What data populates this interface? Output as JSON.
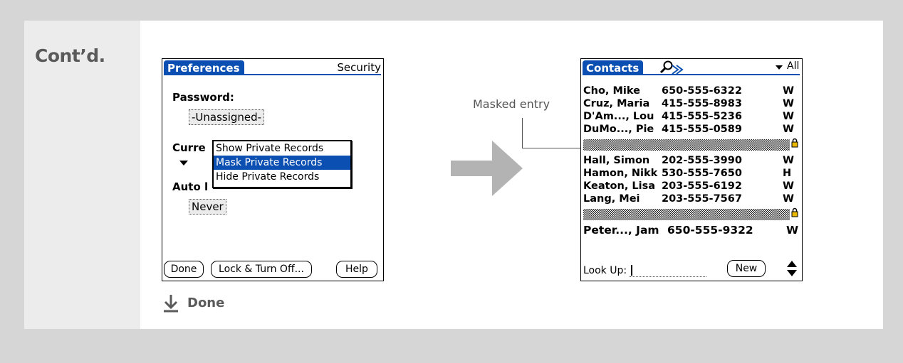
{
  "colors": {
    "accent": "#0b4fb2",
    "arrow": "#b3b3b3",
    "label": "#5a5a5a"
  },
  "header": {
    "continued": "Cont’d."
  },
  "preferences_screen": {
    "title": "Preferences",
    "section": "Security",
    "password_label": "Password:",
    "password_value": "-Unassigned-",
    "current_privacy_label_partial": "Curre",
    "auto_lock_label_partial": "Auto l",
    "auto_lock_value": "Never",
    "buttons": [
      "Done",
      "Lock & Turn Off...",
      "Help"
    ],
    "privacy_menu": {
      "options": [
        "Show Private Records",
        "Mask Private Records",
        "Hide Private Records"
      ],
      "selected": "Mask Private Records"
    }
  },
  "callout": {
    "label": "Masked entry"
  },
  "contacts_screen": {
    "title": "Contacts",
    "category": "All",
    "rows": [
      {
        "name": "Cho, Mike",
        "phone": "650-555-6322",
        "type": "W",
        "masked": false
      },
      {
        "name": "Cruz, Maria",
        "phone": "415-555-8983",
        "type": "W",
        "masked": false
      },
      {
        "name": "D'Am..., Lou",
        "phone": "415-555-5236",
        "type": "W",
        "masked": false
      },
      {
        "name": "DuMo..., Pie",
        "phone": "415-555-0589",
        "type": "W",
        "masked": false
      },
      {
        "name": "",
        "phone": "",
        "type": "",
        "masked": true
      },
      {
        "name": "Hall, Simon",
        "phone": "202-555-3990",
        "type": "W",
        "masked": false
      },
      {
        "name": "Hamon, Nikk",
        "phone": "530-555-7650",
        "type": "H",
        "masked": false
      },
      {
        "name": "Keaton, Lisa",
        "phone": "203-555-6192",
        "type": "W",
        "masked": false
      },
      {
        "name": "Lang, Mei",
        "phone": "203-555-7567",
        "type": "W",
        "masked": false
      },
      {
        "name": "",
        "phone": "",
        "type": "",
        "masked": true
      },
      {
        "name": "Peter..., Jam",
        "phone": "650-555-9322",
        "type": "W",
        "masked": false
      }
    ],
    "lookup_label": "Look Up:",
    "new_button": "New"
  },
  "footer": {
    "done_label": "Done"
  },
  "icons": [
    "right-arrow-icon",
    "down-arrow-icon",
    "lock-icon",
    "search-icon",
    "scroll-arrows-icon",
    "dropdown-triangle-icon"
  ]
}
